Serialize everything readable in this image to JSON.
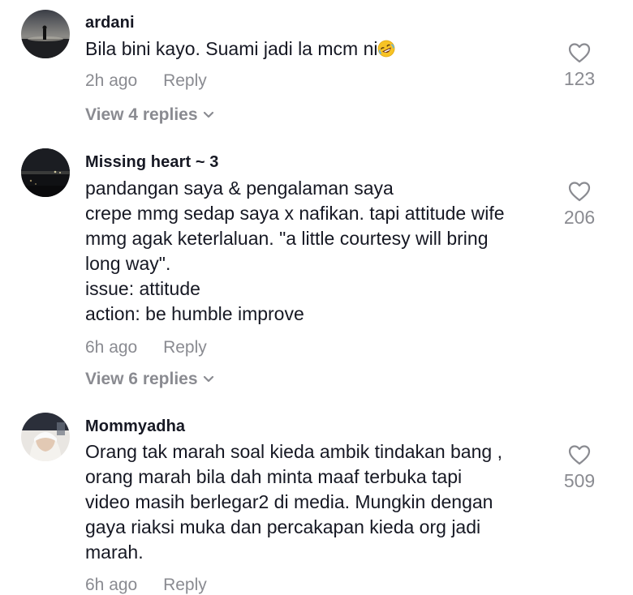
{
  "comments": [
    {
      "username": "ardani",
      "text": "Bila bini kayo. Suami jadi la mcm ni",
      "emoji": "rolling-on-floor-laughing-emoji",
      "time": "2h ago",
      "reply_label": "Reply",
      "likes": "123",
      "view_replies": "View 4 replies"
    },
    {
      "username": "Missing heart ~ 3",
      "text": "pandangan saya & pengalaman saya\ncrepe mmg sedap saya x nafikan. tapi attitude wife\nmmg agak keterlaluan. \"a little courtesy will bring\nlong way\".\nissue: attitude\naction: be humble improve",
      "time": "6h ago",
      "reply_label": "Reply",
      "likes": "206",
      "view_replies": "View 6 replies"
    },
    {
      "username": "Mommyadha",
      "text": "Orang tak marah soal kieda ambik tindakan bang ,\norang marah bila dah minta maaf terbuka tapi\nvideo masih berlegar2 di media. Mungkin dengan\ngaya riaksi muka dan percakapan kieda org jadi\nmarah.",
      "time": "6h ago",
      "reply_label": "Reply",
      "likes": "509"
    }
  ],
  "colors": {
    "text": "#161823",
    "muted": "#8a8b91",
    "background": "#ffffff"
  }
}
